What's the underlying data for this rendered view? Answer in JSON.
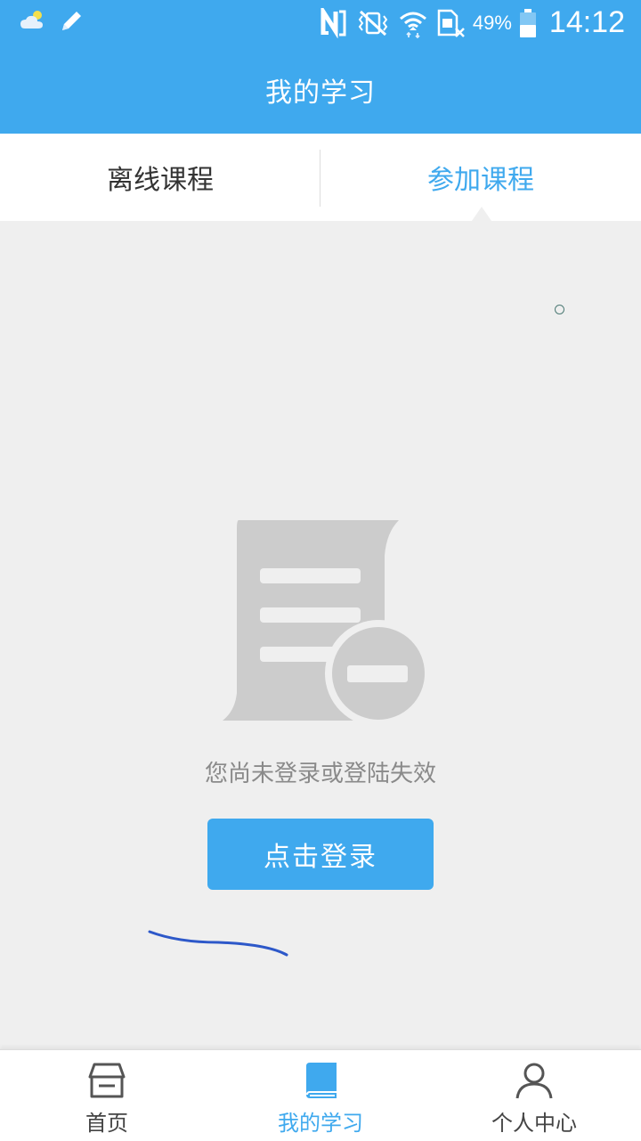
{
  "status_bar": {
    "battery_percent": "49%",
    "time": "14:12",
    "icons": [
      "weather-icon",
      "pencil-icon",
      "nfc-icon",
      "vibrate-icon",
      "wifi-icon",
      "sim-icon",
      "battery-icon"
    ]
  },
  "header": {
    "title": "我的学习"
  },
  "tabs": [
    {
      "label": "离线课程",
      "active": false
    },
    {
      "label": "参加课程",
      "active": true
    }
  ],
  "empty_state": {
    "icon": "document-minus-icon",
    "message": "您尚未登录或登陆失效",
    "login_button_label": "点击登录"
  },
  "bottom_nav": {
    "items": [
      {
        "label": "首页",
        "icon": "home-icon",
        "active": false
      },
      {
        "label": "我的学习",
        "icon": "book-icon",
        "active": true
      },
      {
        "label": "个人中心",
        "icon": "person-icon",
        "active": false
      }
    ]
  },
  "colors": {
    "primary": "#3fa9ee",
    "background": "#efefef",
    "text_dark": "#333333",
    "text_muted": "#8a8a8a",
    "illustration_gray": "#cccccc"
  }
}
